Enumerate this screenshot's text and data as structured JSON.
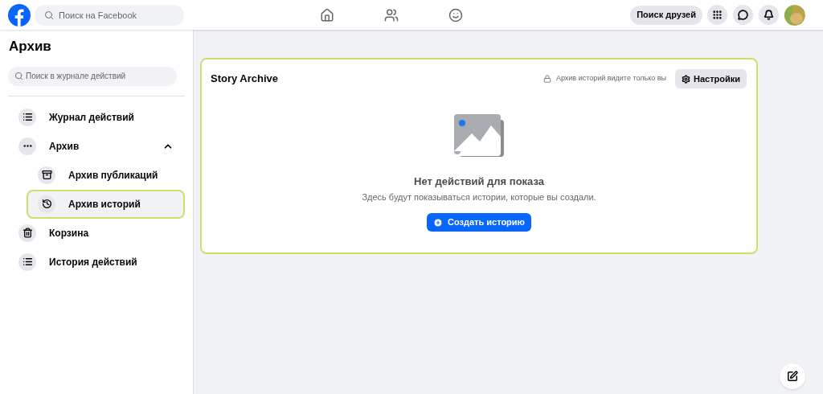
{
  "topbar": {
    "search": {
      "placeholder": "Поиск на Facebook"
    },
    "nav": [
      {
        "kind": "home",
        "selected": false
      },
      {
        "kind": "friends",
        "selected": false
      },
      {
        "kind": "groups",
        "selected": false
      }
    ],
    "find_friends": "Поиск друзей"
  },
  "sidebar": {
    "title": "Архив",
    "search": {
      "placeholder": "Поиск в журнале действий"
    },
    "items": [
      {
        "kind": "list",
        "label": "Журнал действий",
        "selected": false
      },
      {
        "kind": "more",
        "label": "Архив",
        "selected": false,
        "expanded": true,
        "children": [
          {
            "kind": "box",
            "label": "Архив публикаций",
            "selected": false
          },
          {
            "kind": "clock",
            "label": "Архив историй",
            "selected": true
          }
        ]
      },
      {
        "kind": "trash",
        "label": "Корзина",
        "selected": false
      },
      {
        "kind": "list",
        "label": "История действий",
        "selected": false
      }
    ]
  },
  "card": {
    "title": "Story Archive",
    "privacy_note": "Архив историй видите только вы",
    "settings_button": "Настройки",
    "empty_title": "Нет действий для показа",
    "empty_text": "Здесь будут показываться истории, которые вы создали.",
    "create_button": "Создать историю"
  }
}
